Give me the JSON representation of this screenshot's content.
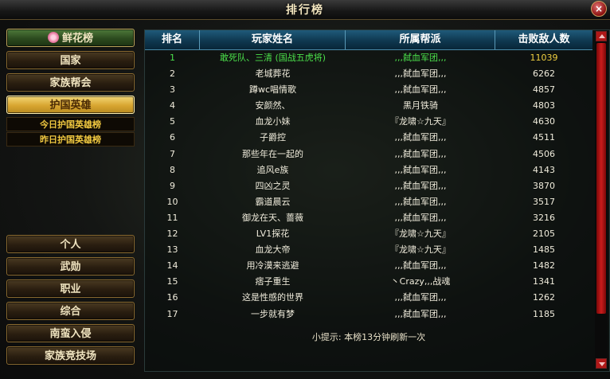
{
  "window": {
    "title": "排行榜",
    "close_label": "×"
  },
  "sidebar": {
    "top_items": [
      {
        "label": "鲜花榜"
      },
      {
        "label": "国家"
      },
      {
        "label": "家族帮会"
      },
      {
        "label": "护国英雄"
      }
    ],
    "sub_items": [
      {
        "label": "今日护国英雄榜"
      },
      {
        "label": "昨日护国英雄榜"
      }
    ],
    "bottom_items": [
      {
        "label": "个人"
      },
      {
        "label": "武勋"
      },
      {
        "label": "职业"
      },
      {
        "label": "综合"
      },
      {
        "label": "南蛮入侵"
      },
      {
        "label": "家族竞技场"
      }
    ]
  },
  "table": {
    "headers": [
      "排名",
      "玩家姓名",
      "所属帮派",
      "击败敌人数"
    ],
    "rows": [
      {
        "rank": "1",
        "name": "敢死队、三清 (国战五虎将)",
        "guild": ",,,弑血军团,,,",
        "kills": "11039"
      },
      {
        "rank": "2",
        "name": "老城葬花",
        "guild": ",,,弑血军团,,,",
        "kills": "6262"
      },
      {
        "rank": "3",
        "name": "蹲wc唱情歌",
        "guild": ",,,弑血军团,,,",
        "kills": "4857"
      },
      {
        "rank": "4",
        "name": "安颜然、",
        "guild": "黑月铁骑",
        "kills": "4803"
      },
      {
        "rank": "5",
        "name": "血龙小妹",
        "guild": "『龙啸☆九天』",
        "kills": "4630"
      },
      {
        "rank": "6",
        "name": "子爵控",
        "guild": ",,,弑血军团,,,",
        "kills": "4511"
      },
      {
        "rank": "7",
        "name": "那些年在一起的",
        "guild": ",,,弑血军团,,,",
        "kills": "4506"
      },
      {
        "rank": "8",
        "name": "追风e族",
        "guild": ",,,弑血军团,,,",
        "kills": "4143"
      },
      {
        "rank": "9",
        "name": "四凶之灵",
        "guild": ",,,弑血军团,,,",
        "kills": "3870"
      },
      {
        "rank": "10",
        "name": "霸道晨云",
        "guild": ",,,弑血军团,,,",
        "kills": "3517"
      },
      {
        "rank": "11",
        "name": "御龙在天、蔷薇",
        "guild": ",,,弑血军团,,,",
        "kills": "3216"
      },
      {
        "rank": "12",
        "name": "LV1探花",
        "guild": "『龙啸☆九天』",
        "kills": "2105"
      },
      {
        "rank": "13",
        "name": "血龙大帝",
        "guild": "『龙啸☆九天』",
        "kills": "1485"
      },
      {
        "rank": "14",
        "name": "用冷漠来逃避",
        "guild": ",,,弑血军团,,,",
        "kills": "1482"
      },
      {
        "rank": "15",
        "name": "痞子重生",
        "guild": "丶Crazy,,,战魂",
        "kills": "1341"
      },
      {
        "rank": "16",
        "name": "这是性感的世界",
        "guild": ",,,弑血军团,,,",
        "kills": "1262"
      },
      {
        "rank": "17",
        "name": "一步就有梦",
        "guild": ",,,弑血军团,,,",
        "kills": "1185"
      }
    ]
  },
  "hint": "小提示: 本榜13分钟刷新一次",
  "colors": {
    "highlight_green": "#4be04b",
    "active_gold": "#d8a631",
    "header_blue": "#0f3850",
    "scroll_red": "#b01818"
  }
}
